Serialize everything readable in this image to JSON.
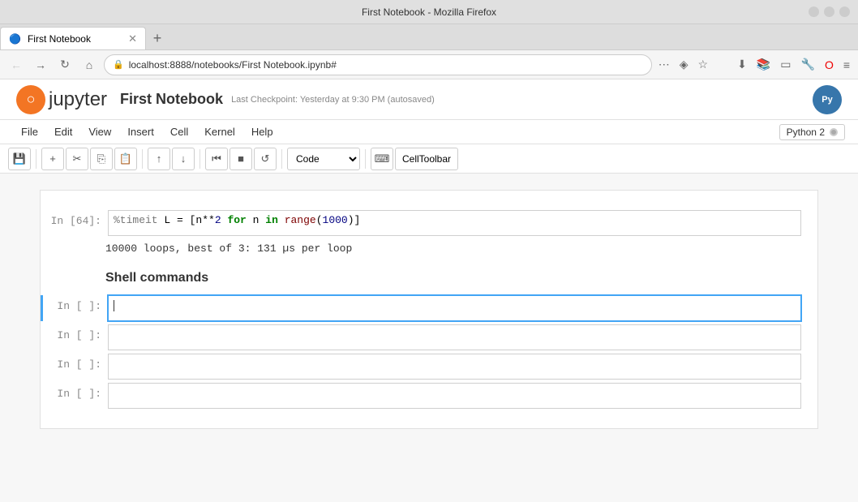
{
  "window": {
    "title": "First Notebook - Mozilla Firefox"
  },
  "browser": {
    "back_title": "Back",
    "forward_title": "Forward",
    "refresh_title": "Refresh",
    "home_title": "Home",
    "address": "localhost:8888/notebooks/First Notebook.ipynb#",
    "tab_title": "First Notebook",
    "new_tab_label": "+"
  },
  "jupyter": {
    "logo_text": "jupyter",
    "notebook_title": "First Notebook",
    "checkpoint": "Last Checkpoint: Yesterday at 9:30 PM (autosaved)",
    "python_label": "Py"
  },
  "menu": {
    "items": [
      "File",
      "Edit",
      "View",
      "Insert",
      "Cell",
      "Kernel",
      "Help"
    ],
    "kernel_name": "Python 2"
  },
  "toolbar": {
    "cell_type": "Code",
    "celltoolbar": "CellToolbar"
  },
  "notebook": {
    "prev_prompt": "In [64]:",
    "prev_code": "%timeit L = [n**2 for n in range(1000)]",
    "prev_output": "10000 loops, best of 3: 131 µs per loop",
    "section_heading": "Shell commands",
    "cells": [
      {
        "prompt": "In [ ]:",
        "focused": true
      },
      {
        "prompt": "In [ ]:",
        "focused": false
      },
      {
        "prompt": "In [ ]:",
        "focused": false
      },
      {
        "prompt": "In [ ]:",
        "focused": false
      }
    ]
  }
}
